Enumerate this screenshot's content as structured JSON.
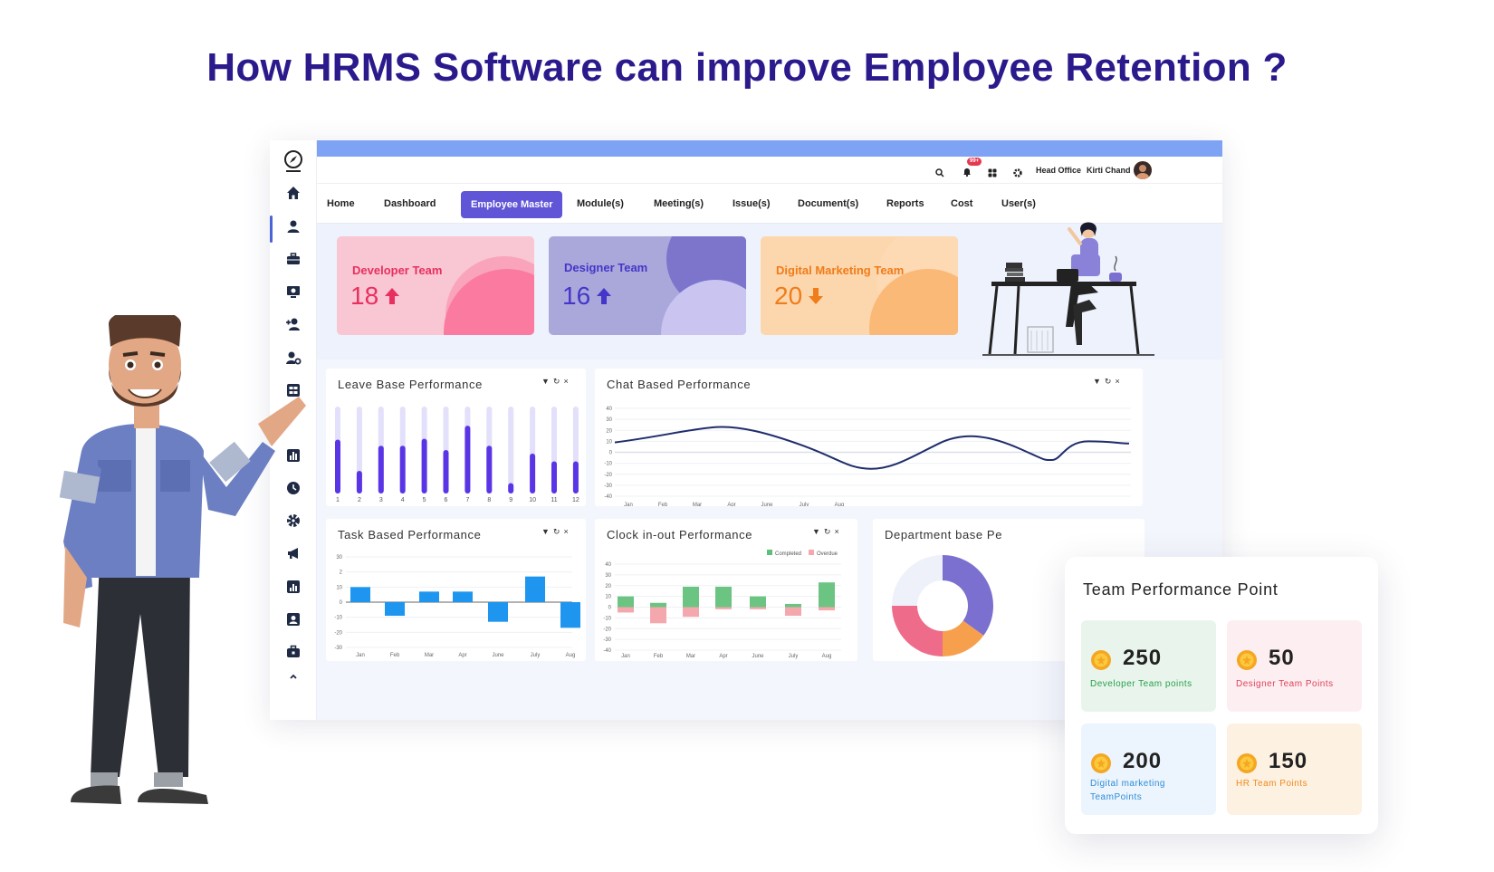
{
  "headline": "How HRMS Software can improve Employee Retention ?",
  "header": {
    "notification_badge": "99+",
    "branch": "Head Office",
    "user_name": "Kirti Chand"
  },
  "nav": {
    "items": [
      "Home",
      "Dashboard",
      "Employee Master",
      "Module(s)",
      "Meeting(s)",
      "Issue(s)",
      "Document(s)",
      "Reports",
      "Cost",
      "User(s)"
    ],
    "active": "Employee Master"
  },
  "sidebar": {
    "icons": [
      "logo-compass-icon",
      "home-icon",
      "user-icon",
      "briefcase-icon",
      "monitor-icon",
      "add-user-icon",
      "user-settings-icon",
      "grid-icon",
      "bar-chart-icon",
      "clock-icon",
      "gear-icon",
      "megaphone-icon",
      "report-icon",
      "id-card-icon",
      "toolbox-icon",
      "chevron-up-icon"
    ]
  },
  "team_cards": [
    {
      "title": "Developer Team",
      "count": "18",
      "trend": "up",
      "color": "#e8305f"
    },
    {
      "title": "Designer Team",
      "count": "16",
      "trend": "up",
      "color": "#4436c9"
    },
    {
      "title": "Digital Marketing Team",
      "count": "20",
      "trend": "down",
      "color": "#f07c1a"
    }
  ],
  "panels": {
    "leave": {
      "title": "Leave Base Performance"
    },
    "chat": {
      "title": "Chat Based Performance"
    },
    "task": {
      "title": "Task Based Performance"
    },
    "clock": {
      "title": "Clock in-out Performance",
      "legend": [
        "Completed",
        "Overdue"
      ]
    },
    "department": {
      "title": "Department base Pe"
    }
  },
  "chart_data": [
    {
      "type": "bar",
      "title": "Leave Base Performance",
      "categories": [
        "1",
        "2",
        "3",
        "4",
        "5",
        "6",
        "7",
        "8",
        "9",
        "10",
        "11",
        "12"
      ],
      "values": [
        62,
        26,
        55,
        55,
        63,
        50,
        78,
        55,
        12,
        46,
        37,
        37
      ],
      "ylim": [
        0,
        100
      ]
    },
    {
      "type": "line",
      "title": "Chat Based Performance",
      "x": [
        "Jan",
        "Feb",
        "Mar",
        "Apr",
        "June",
        "July",
        "Aug"
      ],
      "yticks": [
        40,
        30,
        20,
        10,
        0,
        -10,
        -20,
        -30,
        -40
      ],
      "ylim": [
        -40,
        40
      ]
    },
    {
      "type": "bar",
      "title": "Task Based Performance",
      "categories": [
        "Jan",
        "Feb",
        "Mar",
        "Apr",
        "June",
        "July",
        "Aug"
      ],
      "values": [
        10,
        -9,
        7,
        7,
        -13,
        17,
        -17
      ],
      "yticks": [
        30,
        2,
        10,
        0,
        -10,
        -20,
        -30
      ],
      "ylim": [
        -30,
        30
      ]
    },
    {
      "type": "bar",
      "title": "Clock in-out Performance",
      "categories": [
        "Jan",
        "Feb",
        "Mar",
        "Apr",
        "June",
        "July",
        "Aug"
      ],
      "series": [
        {
          "name": "Completed",
          "values": [
            10,
            4,
            19,
            19,
            10,
            3,
            23
          ]
        },
        {
          "name": "Overdue",
          "values": [
            -5,
            -15,
            -9,
            -2,
            -2,
            -8,
            -3
          ]
        }
      ],
      "yticks": [
        40,
        30,
        20,
        10,
        0,
        -10,
        -20,
        -30,
        -40
      ],
      "ylim": [
        -40,
        40
      ]
    },
    {
      "type": "pie",
      "title": "Department base Pe",
      "values": [
        35,
        15,
        25,
        25
      ],
      "colors": [
        "#7b6fd0",
        "#f6a04d",
        "#ef6b8a",
        "#eef1fa"
      ]
    }
  ],
  "team_points": {
    "title": "Team Performance Point",
    "items": [
      {
        "value": "250",
        "label": "Developer Team points",
        "label_color": "#27a04a",
        "bg": "#e9f5ec"
      },
      {
        "value": "50",
        "label": "Designer Team Points",
        "label_color": "#e0415a",
        "bg": "#fdeff1"
      },
      {
        "value": "200",
        "label": "Digital marketing TeamPoints",
        "label_color": "#2d8ed8",
        "bg": "#ecf4fd"
      },
      {
        "value": "150",
        "label": "HR Team Points",
        "label_color": "#f08a1f",
        "bg": "#fdf1e1"
      }
    ]
  },
  "colors": {
    "headline": "#2a1a8c",
    "accent": "#5f55d6",
    "topbar": "#7ea3f4"
  }
}
